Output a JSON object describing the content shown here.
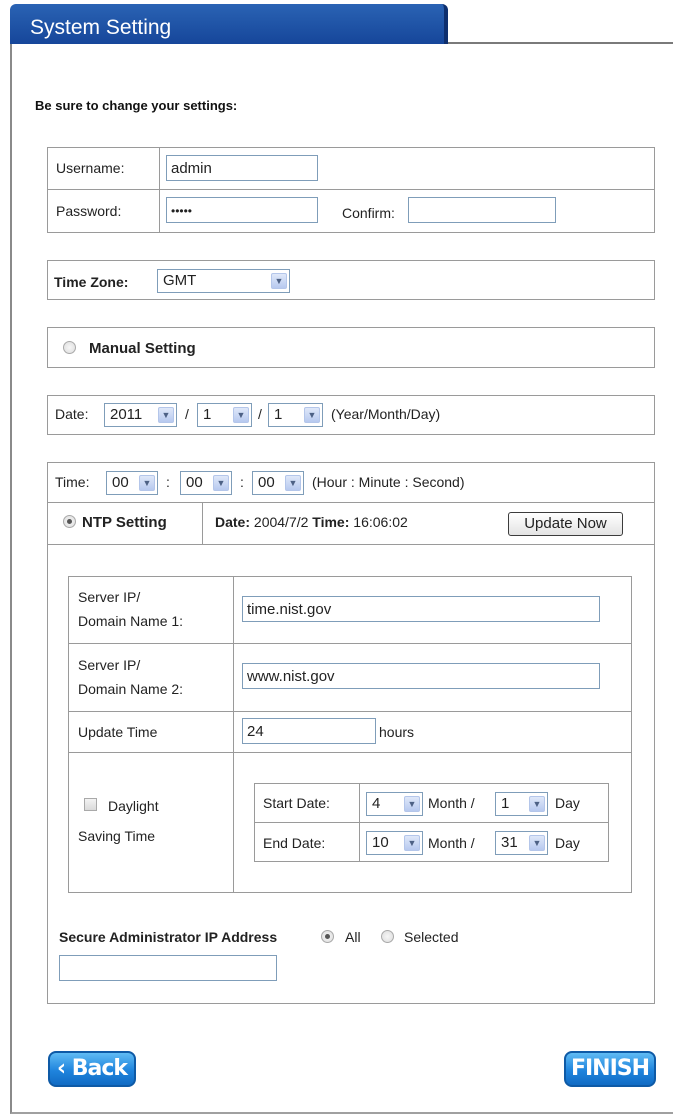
{
  "title": "System Setting",
  "heading": "Be sure to change your settings:",
  "account": {
    "username_label": "Username:",
    "username_value": "admin",
    "password_label": "Password:",
    "password_value": "•••••",
    "confirm_label": "Confirm:",
    "confirm_value": ""
  },
  "timezone": {
    "label": "Time Zone:",
    "value": "GMT"
  },
  "manual": {
    "label": "Manual Setting"
  },
  "date": {
    "label": "Date:",
    "year": "2011",
    "month": "1",
    "day": "1",
    "sep": "/",
    "format": "(Year/Month/Day)"
  },
  "time": {
    "label": "Time:",
    "hour": "00",
    "minute": "00",
    "second": "00",
    "sep": ":",
    "format": "(Hour : Minute : Second)"
  },
  "ntp": {
    "label": "NTP Setting",
    "date_label": "Date:",
    "date_value": "2004/7/2",
    "time_label": "Time:",
    "time_value": "16:06:02",
    "update_button": "Update Now",
    "server1_label_a": "Server IP/",
    "server1_label_b": "Domain Name 1:",
    "server1_value": "time.nist.gov",
    "server2_label_a": "Server IP/",
    "server2_label_b": "Domain Name 2:",
    "server2_value": "www.nist.gov",
    "update_time_label": "Update Time",
    "update_time_value": "24",
    "update_time_unit": "hours",
    "dst_label_a": "Daylight",
    "dst_label_b": "Saving Time",
    "start_label": "Start Date:",
    "start_month": "4",
    "start_day": "1",
    "end_label": "End Date:",
    "end_month": "10",
    "end_day": "31",
    "month_word": "Month /",
    "day_word": "Day"
  },
  "secure": {
    "label": "Secure Administrator IP Address",
    "all": "All",
    "selected": "Selected",
    "ip_value": ""
  },
  "nav": {
    "back": "‹ Back",
    "finish": "FINISH"
  },
  "colors": {
    "title_bg": "#16469a",
    "nav_bg": "#1f84dd"
  }
}
